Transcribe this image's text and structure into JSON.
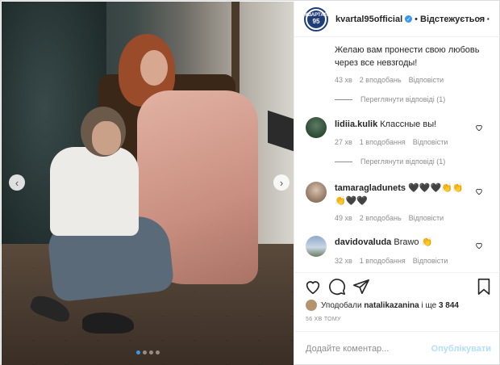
{
  "post": {
    "username": "kvartal95official",
    "follow_label": "Відстежується",
    "logo_line1": "КВАРТАЛ",
    "logo_line2": "95"
  },
  "comments": [
    {
      "text": "Желаю вам пронести свою любовь через все невзгоды!",
      "time": "43 хв",
      "likes": "2 вподобань",
      "reply": "Відповісти",
      "view_replies": "Переглянути відповіді (1)"
    },
    {
      "username": "lidiia.kulik",
      "text": "Классные вы!",
      "time": "27 хв",
      "likes": "1 вподобання",
      "reply": "Відповісти",
      "view_replies": "Переглянути відповіді (1)"
    },
    {
      "username": "tamaragladunets",
      "text": "🖤🖤🖤👏👏👏🖤🖤",
      "time": "49 хв",
      "likes": "2 вподобань",
      "reply": "Відповісти"
    },
    {
      "username": "davidovaluda",
      "text": "Brawo 👏",
      "time": "32 хв",
      "likes": "1 вподобання",
      "reply": "Відповісти"
    }
  ],
  "likes": {
    "prefix": "Уподобали",
    "user": "natalikazanina",
    "and_more": "і ще",
    "count": "3 844"
  },
  "time_ago": "56 ХВ ТОМУ",
  "comment_box": {
    "placeholder": "Додайте коментар...",
    "publish_label": "Опублікувати"
  },
  "carousel": {
    "total": 4,
    "active": 1
  },
  "colors": {
    "accent": "#3897f0",
    "publish_disabled": "#b2dffc",
    "logo": "#1f3d7a"
  }
}
